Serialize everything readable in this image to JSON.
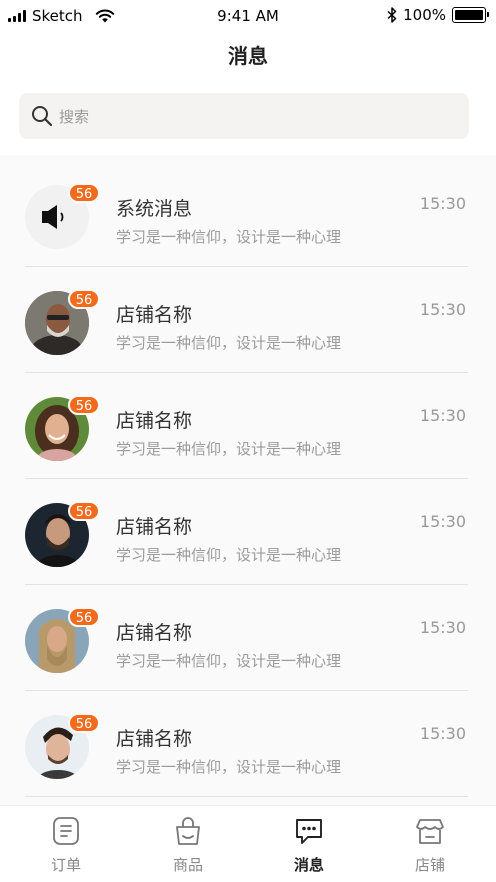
{
  "status_bar": {
    "carrier": "Sketch",
    "time": "9:41 AM",
    "battery": "100%",
    "icons": [
      "signal-icon",
      "wifi-icon",
      "bluetooth-icon",
      "battery-icon"
    ]
  },
  "header": {
    "title": "消息"
  },
  "search": {
    "placeholder": "搜索",
    "icon": "search-icon"
  },
  "messages": [
    {
      "title": "系统消息",
      "preview": "学习是一种信仰，设计是一种心理",
      "time": "15:30",
      "badge": "56",
      "avatar": "speaker-icon"
    },
    {
      "title": "店铺名称",
      "preview": "学习是一种信仰，设计是一种心理",
      "time": "15:30",
      "badge": "56",
      "avatar": "user-avatar"
    },
    {
      "title": "店铺名称",
      "preview": "学习是一种信仰，设计是一种心理",
      "time": "15:30",
      "badge": "56",
      "avatar": "user-avatar"
    },
    {
      "title": "店铺名称",
      "preview": "学习是一种信仰，设计是一种心理",
      "time": "15:30",
      "badge": "56",
      "avatar": "user-avatar"
    },
    {
      "title": "店铺名称",
      "preview": "学习是一种信仰，设计是一种心理",
      "time": "15:30",
      "badge": "56",
      "avatar": "user-avatar"
    },
    {
      "title": "店铺名称",
      "preview": "学习是一种信仰，设计是一种心理",
      "time": "15:30",
      "badge": "56",
      "avatar": "user-avatar"
    }
  ],
  "tab_bar": {
    "tabs": [
      {
        "label": "订单",
        "icon": "order-icon",
        "active": false
      },
      {
        "label": "商品",
        "icon": "bag-icon",
        "active": false
      },
      {
        "label": "消息",
        "icon": "chat-icon",
        "active": true
      },
      {
        "label": "店铺",
        "icon": "shop-icon",
        "active": false
      }
    ]
  },
  "colors": {
    "badge": "#f26a1b",
    "search_bg": "#f4f3f1",
    "list_bg": "#fafafa"
  }
}
